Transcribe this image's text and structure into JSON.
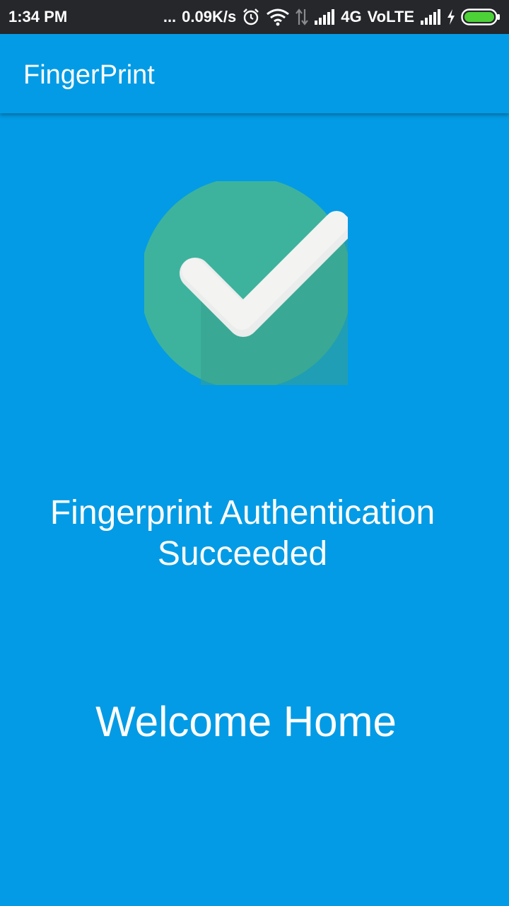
{
  "status_bar": {
    "time": "1:34 PM",
    "dots": "...",
    "speed": "0.09K/s",
    "network": "4G",
    "volte": "VoLTE",
    "icons": [
      "alarm-icon",
      "wifi-icon",
      "data-arrows-icon",
      "signal-icon",
      "signal-icon",
      "charging-icon",
      "battery-icon"
    ],
    "battery_color": "#4CD137"
  },
  "app_bar": {
    "title": "FingerPrint",
    "color": "#039BE5"
  },
  "main": {
    "status_icon": "check-circle-icon",
    "status_icon_color": "#3DB39E",
    "auth_line1": "Fingerprint Authentication",
    "auth_line2": "Succeeded",
    "welcome": "Welcome Home",
    "background": "#039BE5"
  }
}
